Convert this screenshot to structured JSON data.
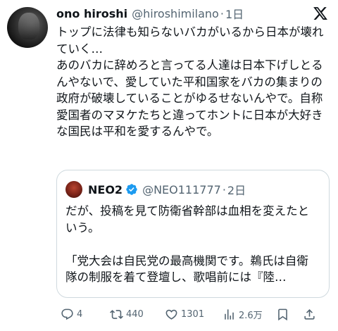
{
  "author": {
    "display_name": "ono hiroshi",
    "handle": "@hiroshimilano",
    "separator": "·",
    "time": "1日"
  },
  "post_text": "トップに法律も知らないバカがいるから日本が壊れていく…\nあのバカに辞めろと言ってる人達は日本下げしとるんやないで、愛していた平和国家をバカの集まりの政府が破壊していることがゆるせないんやで。自称愛国者のマヌケたちと違ってホントに日本が大好きな国民は平和を愛するんやで。",
  "quote": {
    "display_name": "NEO2",
    "handle": "@NEO111777",
    "separator": "·",
    "time": "2日",
    "text": "だが、投稿を見て防衛省幹部は血相を変えたという。\n\n「党大会は自民党の最高機関です。鵜氏は自衛隊の制服を着て登壇し、歌唱前には『陸…"
  },
  "actions": {
    "reply_count": "4",
    "repost_count": "440",
    "like_count": "1301",
    "view_count": "2.6万"
  },
  "colors": {
    "text": "#0f1419",
    "secondary": "#536471",
    "border": "#cfd9de",
    "verified": "#1d9bf0"
  },
  "icons": [
    "x-logo-icon",
    "verified-badge-icon",
    "reply-icon",
    "repost-icon",
    "like-icon",
    "views-icon",
    "bookmark-icon",
    "share-icon"
  ]
}
